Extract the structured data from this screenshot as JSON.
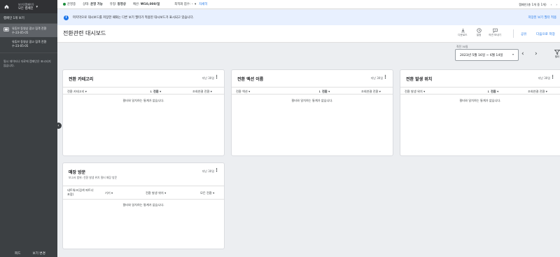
{
  "sidebar": {
    "view_label": "보기(캠페인)",
    "view_name": "모든 캠페인",
    "campaign_count": "캠페인 1개 보기",
    "campaigns": [
      {
        "name": "유튜브 동영상 광고 집객 전환수-23-05-05"
      },
      {
        "name": "유튜브 동영상 광고 집객 전환수-23-05-05"
      }
    ],
    "note": "필시 데이터나 자료에 캠페인은 표시되지 않습니다.",
    "bottom_left": "피드",
    "bottom_right": "보기 변경"
  },
  "topbar": {
    "status": "운영중",
    "state_label": "상태:",
    "state_value": "운영 가능",
    "type_label": "유형:",
    "type_value": "동영상",
    "budget_label": "예산:",
    "budget_value": "₩10,000/일",
    "filter_label": "최적화 점수:",
    "filter_value": "–",
    "detail": "자세히",
    "range": "캠페인(총 1개 중 1개)"
  },
  "banner": {
    "text": "마지막으로 대시보드를 저장한 때와는 다른 보기 필터가 적용된 대시보드가 표시되고 있습니다.",
    "link": "저장된 보기 필터 적용"
  },
  "header": {
    "title": "전환관련 대시보드",
    "download_label": "다운로드",
    "history_label": "일정",
    "feedback_label": "의견 보내기",
    "apply_label": "공유",
    "save_as_label": "다음으로 저장"
  },
  "date": {
    "label": "직전 30일",
    "value": "2023년 5월 16일 ~ 6월 14일",
    "filter_label": "필터"
  },
  "cards": [
    {
      "title": "전환 카테고리",
      "period": "지난 30일",
      "columns": [
        "전환 카테고리",
        "전환",
        "조회연결 전환"
      ],
      "empty": "필터와 일치하는 통계가 없습니다."
    },
    {
      "title": "전환 액션 이름",
      "period": "지난 30일",
      "columns": [
        "전환 액션",
        "전환",
        "조회연결 전환"
      ],
      "empty": "필터와 일치하는 통계가 없습니다."
    },
    {
      "title": "전환 발생 위치",
      "period": "지난 30일",
      "columns": [
        "전환 발생 위치",
        "전환",
        "조회연결 전환"
      ],
      "empty": "필터와 일치하는 통계가 없습니다."
    },
    {
      "title": "매장 방문",
      "subtitle": "보고서 범위: 전환 발생 위치 필터 매장 방문",
      "period": "지난 30일",
      "columns": [
        "네트워크(검색 파트너 포함)",
        "기기",
        "전환 발생 위치",
        "모든 전환"
      ],
      "empty": "필터와 일치하는 통계가 없습니다."
    }
  ],
  "colors": {
    "sidebar": "#3c4043",
    "accent": "#1a73e8",
    "status_green": "#1e8e3e",
    "banner": "#e8f0fe"
  }
}
